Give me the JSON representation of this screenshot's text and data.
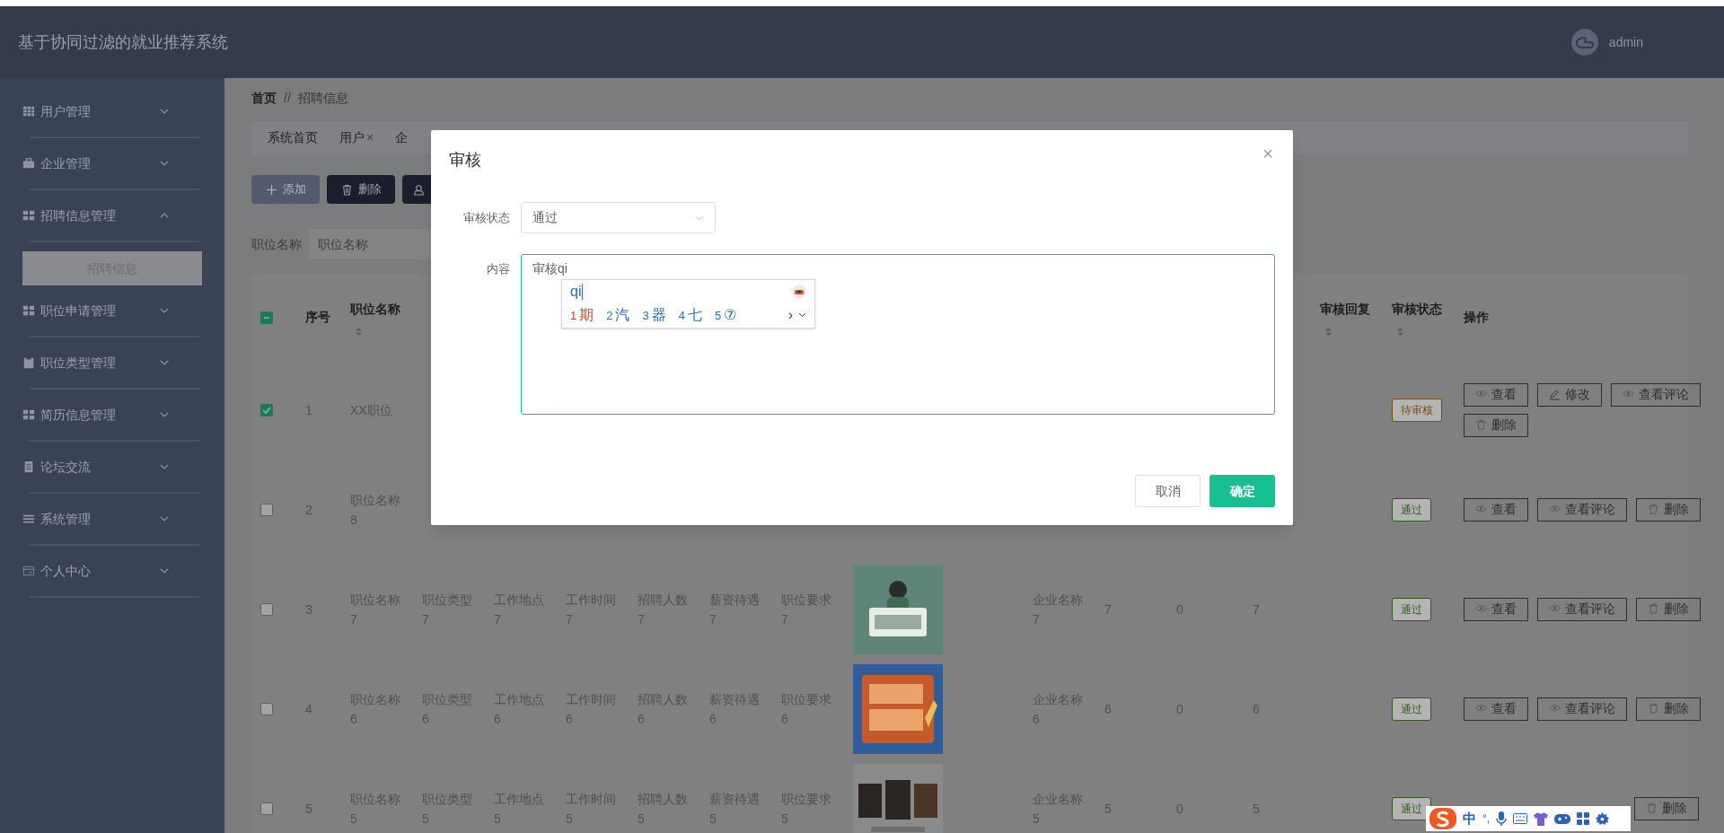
{
  "header": {
    "title": "基于协同过滤的就业推荐系统",
    "user": "admin"
  },
  "sidebar": {
    "items": [
      {
        "label": "用户管理",
        "kind": "table",
        "expanded": false
      },
      {
        "label": "企业管理",
        "kind": "briefcase",
        "expanded": false
      },
      {
        "label": "招聘信息管理",
        "kind": "tiles",
        "expanded": true,
        "children": [
          {
            "label": "招聘信息",
            "selected": true
          }
        ]
      },
      {
        "label": "职位申请管理",
        "kind": "tiles",
        "expanded": false
      },
      {
        "label": "职位类型管理",
        "kind": "clipboard",
        "expanded": false
      },
      {
        "label": "简历信息管理",
        "kind": "tiles",
        "expanded": false
      },
      {
        "label": "论坛交流",
        "kind": "doc",
        "expanded": false
      },
      {
        "label": "系统管理",
        "kind": "bars",
        "expanded": false
      },
      {
        "label": "个人中心",
        "kind": "card",
        "expanded": false
      }
    ]
  },
  "breadcrumb": {
    "items": [
      "首页",
      "招聘信息"
    ],
    "separator": "//"
  },
  "tabs": [
    {
      "label": "系统首页"
    },
    {
      "label": "用户",
      "close": "×"
    },
    {
      "label": "企"
    }
  ],
  "toolbar": {
    "buttons": [
      {
        "label": "添加",
        "kind": "add"
      },
      {
        "label": "删除",
        "kind": "delete"
      },
      {
        "kind": "user"
      }
    ]
  },
  "search": {
    "label": "职位名称",
    "placeholder": "职位名称"
  },
  "table": {
    "select_all": {
      "indeterminate": true
    },
    "columns": [
      {
        "label": "序号",
        "sortable": false
      },
      {
        "label": "职位名称",
        "sortable": true
      },
      null,
      null,
      null,
      null,
      null,
      null,
      null,
      null,
      null,
      null,
      null,
      {
        "label": "审核回复",
        "sortable": true
      },
      {
        "label": "审核状态",
        "sortable": true
      },
      {
        "label": "操作",
        "sortable": false
      }
    ],
    "rows": [
      {
        "checked": true,
        "cells": [
          "1",
          "XX职位",
          null,
          null,
          null,
          null,
          null,
          null,
          null,
          null,
          null,
          null,
          null,
          null
        ],
        "status": {
          "label": "待审核",
          "color": "#7a4a12"
        },
        "actions": [
          {
            "label": "查看",
            "kind": "view"
          },
          {
            "label": "修改",
            "kind": "edit"
          },
          {
            "label": "查看评论",
            "kind": "view"
          },
          {
            "label": "删除",
            "kind": "delete"
          }
        ]
      },
      {
        "checked": false,
        "cells": [
          "2",
          "职位名称8",
          null,
          null,
          null,
          null,
          null,
          null,
          null,
          null,
          null,
          null,
          null,
          null
        ],
        "status": {
          "label": "通过",
          "color": "#2f5a1f"
        },
        "actions": [
          {
            "label": "查看",
            "kind": "view"
          },
          {
            "label": "查看评论",
            "kind": "view"
          },
          {
            "label": "删除",
            "kind": "delete"
          }
        ]
      },
      {
        "checked": false,
        "cells": [
          "3",
          "职位名称7",
          "职位类型7",
          "工作地点7",
          "工作时间7",
          "招聘人数7",
          "薪资待遇7",
          "职位要求7",
          null,
          "企业名称7",
          "7",
          "0",
          "7",
          null
        ],
        "picture": {
          "kind": "picture"
        },
        "status": {
          "label": "通过",
          "color": "#2f5a1f"
        },
        "actions": [
          {
            "label": "查看",
            "kind": "view"
          },
          {
            "label": "查看评论",
            "kind": "view"
          },
          {
            "label": "删除",
            "kind": "delete"
          }
        ]
      },
      {
        "checked": false,
        "cells": [
          "4",
          "职位名称6",
          "职位类型6",
          "工作地点6",
          "工作时间6",
          "招聘人数6",
          "薪资待遇6",
          "职位要求6",
          null,
          "企业名称6",
          "6",
          "0",
          "6",
          null
        ],
        "picture": {
          "kind": "picture"
        },
        "status": {
          "label": "通过",
          "color": "#2f5a1f"
        },
        "actions": [
          {
            "label": "查看",
            "kind": "view"
          },
          {
            "label": "查看评论",
            "kind": "view"
          },
          {
            "label": "删除",
            "kind": "delete"
          }
        ]
      },
      {
        "checked": false,
        "cells": [
          "5",
          "职位名称5",
          "职位类型5",
          "工作地点5",
          "工作时间5",
          "招聘人数5",
          "薪资待遇5",
          "职位要求5",
          null,
          "企业名称5",
          "5",
          "0",
          "5",
          null
        ],
        "picture": {
          "kind": "picture"
        },
        "status": {
          "label": "通过",
          "color": "#2f5a1f"
        },
        "actions": [
          {
            "label": "删除",
            "kind": "delete"
          }
        ]
      }
    ]
  },
  "dialog": {
    "title": "审核",
    "close": "×",
    "fields": [
      {
        "label": "审核状态",
        "kind": "select",
        "value": "通过"
      },
      {
        "label": "内容",
        "kind": "textarea",
        "value": "审核qi",
        "focused": true
      }
    ],
    "buttons": [
      {
        "label": "取消",
        "kind": "default"
      },
      {
        "label": "确定",
        "kind": "primary"
      }
    ]
  },
  "ime_popup": {
    "input": "qi",
    "candidates": [
      {
        "number": "1",
        "text": "期",
        "selected": true
      },
      {
        "number": "2",
        "text": "汽",
        "selected": false
      },
      {
        "number": "3",
        "text": "器",
        "selected": false
      },
      {
        "number": "4",
        "text": "七",
        "selected": false
      },
      {
        "number": "5",
        "text": "⑦",
        "selected": false
      }
    ],
    "next": "›"
  },
  "ime_toolbar": {
    "mode": "中",
    "punctuation": "°,"
  }
}
